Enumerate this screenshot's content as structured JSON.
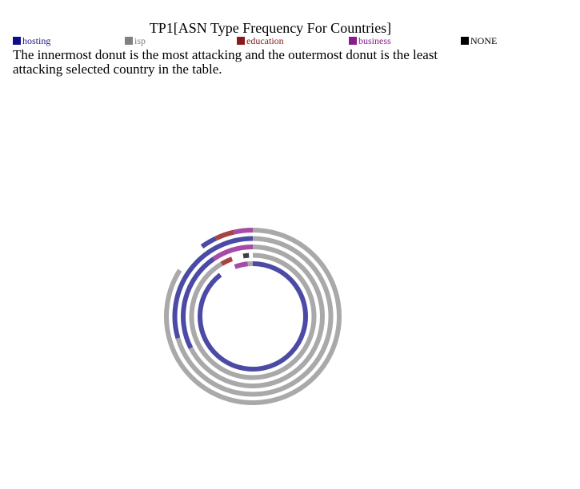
{
  "title": "TP1[ASN Type Frequency For Countries]",
  "note": "The innermost donut is the most attacking and the outermost donut is the least attacking selected country in the table.",
  "legend": [
    {
      "label": "hosting",
      "swatch": "#0d0d8c",
      "text_color": "#1a1a80"
    },
    {
      "label": "isp",
      "swatch": "#808080",
      "text_color": "#808080"
    },
    {
      "label": "education",
      "swatch": "#8b1a1a",
      "text_color": "#8b1a1a"
    },
    {
      "label": "business",
      "swatch": "#8b1a8b",
      "text_color": "#8b1a8b"
    },
    {
      "label": "NONE",
      "swatch": "#000000",
      "text_color": "#000000"
    }
  ],
  "chart_data": {
    "type": "donut",
    "title": "TP1[ASN Type Frequency For Countries]",
    "categories": [
      "hosting",
      "isp",
      "education",
      "business",
      "NONE"
    ],
    "colors": {
      "hosting": "#4b4ba6",
      "isp": "#a9a9a9",
      "education": "#a94242",
      "business": "#a64ba6",
      "NONE": "#404040"
    },
    "rings": [
      {
        "values": {
          "hosting": 89.5,
          "isp": 1.5,
          "education": 0,
          "business": 4.0,
          "NONE": 0
        }
      },
      {
        "values": {
          "hosting": 0,
          "isp": 91.5,
          "education": 3.0,
          "business": 0,
          "NONE": 1.5
        }
      },
      {
        "values": {
          "hosting": 0,
          "isp": 67.5,
          "education": 0,
          "business": 0,
          "NONE": 0
        }
      },
      {
        "values": {
          "hosting": 0,
          "isp": 70.5,
          "education": 0,
          "business": 0,
          "NONE": 0
        }
      },
      {
        "values": {
          "hosting": 0,
          "isp": 96.5,
          "education": 0,
          "business": 3.5,
          "NONE": 0
        }
      }
    ],
    "segments": [
      [
        {
          "category": "hosting",
          "start": 0,
          "end": 89.5
        },
        {
          "category": "business",
          "start": 94.5,
          "end": 98.5
        },
        {
          "category": "isp",
          "start": 98.5,
          "end": 100
        }
      ],
      [
        {
          "category": "isp",
          "start": 0,
          "end": 91.5
        },
        {
          "category": "education",
          "start": 91.5,
          "end": 94.5
        },
        {
          "category": "NONE",
          "start": 97.5,
          "end": 99
        }
      ],
      [
        {
          "category": "isp",
          "start": 0,
          "end": 67.5
        },
        {
          "category": "hosting",
          "start": 67.5,
          "end": 90.5
        },
        {
          "category": "business",
          "start": 90.5,
          "end": 100
        }
      ],
      [
        {
          "category": "isp",
          "start": 0,
          "end": 70.5
        },
        {
          "category": "hosting",
          "start": 70.5,
          "end": 100
        }
      ],
      [
        {
          "category": "isp",
          "start": 0,
          "end": 84
        },
        {
          "category": "hosting",
          "start": 90,
          "end": 93
        },
        {
          "category": "education",
          "start": 93,
          "end": 96.5
        },
        {
          "category": "business",
          "start": 96.5,
          "end": 100
        }
      ]
    ]
  }
}
